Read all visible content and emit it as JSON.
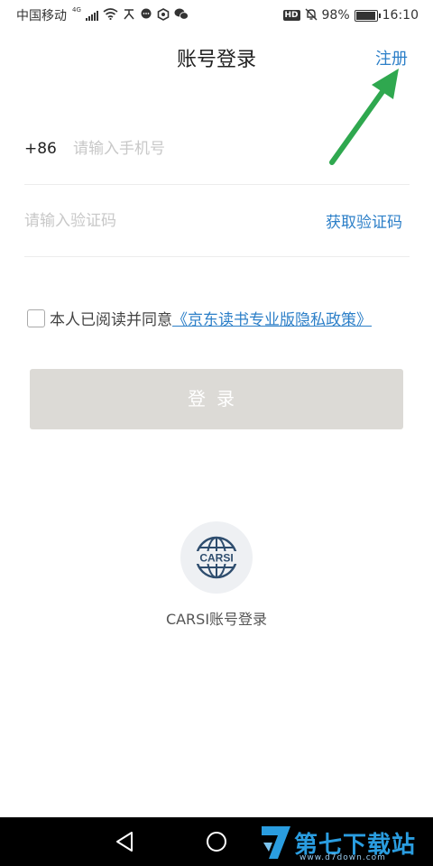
{
  "status_bar": {
    "carrier": "中国移动",
    "network": "4G",
    "battery_percent": "98%",
    "battery_level": 0.98,
    "time": "16:10",
    "hd_badge": "HD"
  },
  "header": {
    "title": "账号登录",
    "register_label": "注册"
  },
  "form": {
    "country_code": "+86",
    "phone_placeholder": "请输入手机号",
    "code_placeholder": "请输入验证码",
    "get_code_label": "获取验证码"
  },
  "agreement": {
    "prefix": "本人已阅读并同意",
    "policy_link": "《京东读书专业版隐私政策》",
    "checked": false
  },
  "login_button": {
    "label": "登录"
  },
  "carsi": {
    "logo_text": "CARSI",
    "label": "CARSI账号登录"
  },
  "watermark": {
    "text": "第七下载站",
    "url": "www.d7down.com"
  },
  "colors": {
    "accent": "#2c7fc8",
    "button_disabled": "#dcdad6",
    "annotation_arrow": "#2fa84f",
    "nav_bar": "#000000"
  }
}
